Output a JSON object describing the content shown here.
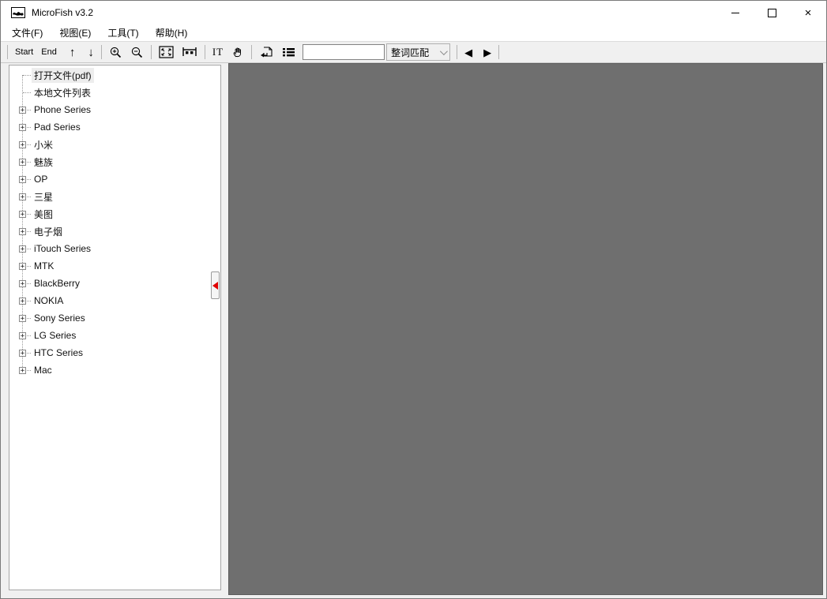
{
  "window": {
    "title": "MicroFish v3.2",
    "controls": {
      "minimize_icon": "minimize-bar",
      "maximize_icon": "maximize-square",
      "close_glyph": "×"
    }
  },
  "menu": {
    "items": [
      {
        "label": "文件(F)"
      },
      {
        "label": "视图(E)"
      },
      {
        "label": "工具(T)"
      },
      {
        "label": "帮助(H)"
      }
    ]
  },
  "toolbar": {
    "start_label": "Start",
    "end_label": "End",
    "glyphs": {
      "up": "↑",
      "down": "↓",
      "prev": "◀",
      "next": "▶",
      "text_select": "IT"
    },
    "icons": [
      "up-arrow",
      "down-arrow",
      "zoom-in",
      "zoom-out",
      "fit-page",
      "fit-width",
      "text-select",
      "hand-pan",
      "page-jump",
      "list-view",
      "prev-result",
      "next-result"
    ],
    "search": {
      "value": "",
      "placeholder": ""
    },
    "match_mode": "整词匹配"
  },
  "sidebar": {
    "expander_glyph": "+",
    "items": [
      {
        "label": "打开文件(pdf)",
        "expandable": false,
        "selected": true
      },
      {
        "label": "本地文件列表",
        "expandable": false,
        "selected": false
      },
      {
        "label": "Phone Series",
        "expandable": true,
        "selected": false
      },
      {
        "label": "Pad Series",
        "expandable": true,
        "selected": false
      },
      {
        "label": "小米",
        "expandable": true,
        "selected": false
      },
      {
        "label": "魅族",
        "expandable": true,
        "selected": false
      },
      {
        "label": "OP",
        "expandable": true,
        "selected": false
      },
      {
        "label": "三星",
        "expandable": true,
        "selected": false
      },
      {
        "label": "美图",
        "expandable": true,
        "selected": false
      },
      {
        "label": "电子烟",
        "expandable": true,
        "selected": false
      },
      {
        "label": "iTouch Series",
        "expandable": true,
        "selected": false
      },
      {
        "label": "MTK",
        "expandable": true,
        "selected": false
      },
      {
        "label": "BlackBerry",
        "expandable": true,
        "selected": false
      },
      {
        "label": "NOKIA",
        "expandable": true,
        "selected": false
      },
      {
        "label": "Sony Series",
        "expandable": true,
        "selected": false
      },
      {
        "label": "LG Series",
        "expandable": true,
        "selected": false
      },
      {
        "label": "HTC Series",
        "expandable": true,
        "selected": false
      },
      {
        "label": "Mac",
        "expandable": true,
        "selected": false
      }
    ]
  },
  "main": {
    "background": "#6f6f6f"
  }
}
